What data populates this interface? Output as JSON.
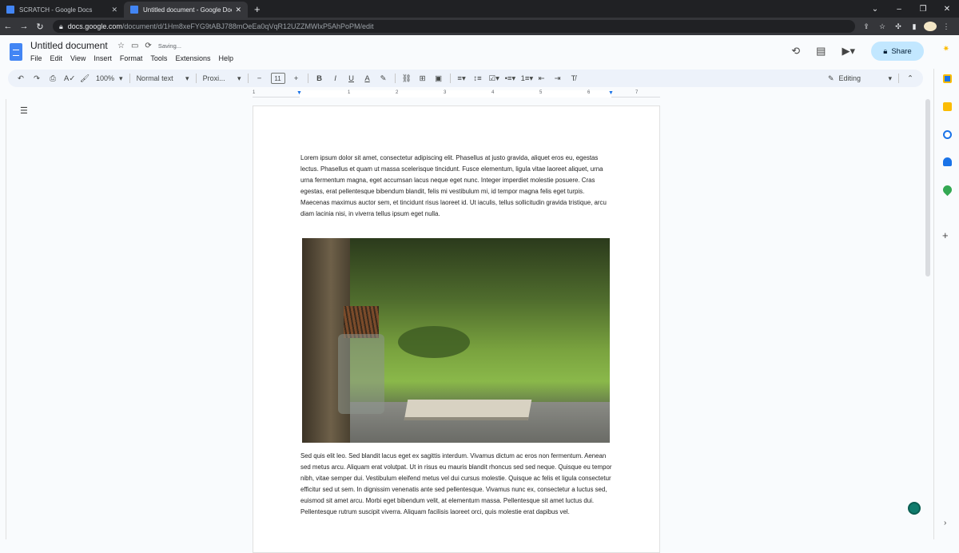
{
  "browser": {
    "tabs": [
      {
        "title": "SCRATCH - Google Docs",
        "active": false
      },
      {
        "title": "Untitled document - Google Docs",
        "active": true
      }
    ],
    "url_host": "docs.google.com",
    "url_path": "/document/d/1Hm8xeFYG9tABJ788mOeEa0qVqR12UZZMWlxP5AhPoPM/edit"
  },
  "doc": {
    "title": "Untitled document",
    "save_status": "Saving...",
    "menu": [
      "File",
      "Edit",
      "View",
      "Insert",
      "Format",
      "Tools",
      "Extensions",
      "Help"
    ],
    "share_label": "Share"
  },
  "toolbar": {
    "zoom": "100%",
    "style": "Normal text",
    "font": "Proxi...",
    "font_size": "11",
    "mode": "Editing"
  },
  "ruler": {
    "numbers": [
      "1",
      "1",
      "2",
      "3",
      "4",
      "5",
      "6",
      "7"
    ]
  },
  "content": {
    "paragraph1": "Lorem ipsum dolor sit amet, consectetur adipiscing elit. Phasellus at justo gravida, aliquet eros eu, egestas lectus. Phasellus et quam ut massa scelerisque tincidunt. Fusce elementum, ligula vitae laoreet aliquet, urna urna fermentum magna, eget accumsan lacus neque eget nunc. Integer imperdiet molestie posuere. Cras egestas, erat pellentesque bibendum blandit, felis mi vestibulum mi, id tempor magna felis eget turpis. Maecenas maximus auctor sem, et tincidunt risus laoreet id. Ut iaculis, tellus sollicitudin gravida tristique, arcu diam lacinia nisi, in viverra tellus ipsum eget nulla.",
    "paragraph2": "Sed quis elit leo. Sed blandit lacus eget ex sagittis interdum. Vivamus dictum ac eros non fermentum. Aenean sed metus arcu. Aliquam erat volutpat. Ut in risus eu mauris blandit rhoncus sed sed neque. Quisque eu tempor nibh, vitae semper dui. Vestibulum eleifend metus vel dui cursus molestie. Quisque ac felis et ligula consectetur efficitur sed ut sem. In dignissim venenatis ante sed pellentesque. Vivamus nunc ex, consectetur a luctus sed, euismod sit amet arcu. Morbi eget bibendum velit, at elementum massa. Pellentesque sit amet luctus dui. Pellentesque rutrum suscipit viverra. Aliquam facilisis laoreet orci, quis molestie erat dapibus vel."
  },
  "colors": {
    "share_bg": "#c2e7ff",
    "docs_blue": "#4285f4",
    "toolbar_bg": "#edf2fa"
  }
}
